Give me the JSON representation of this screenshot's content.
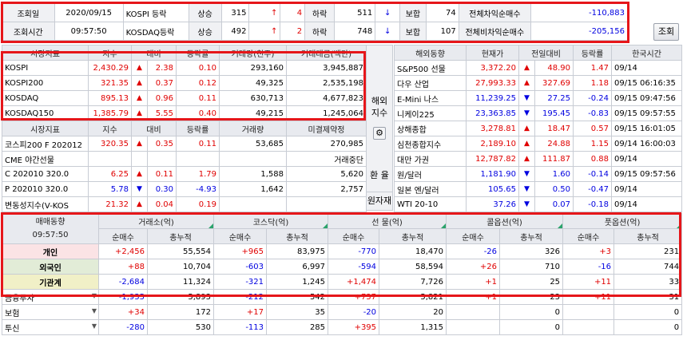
{
  "top": {
    "date_label": "조회일",
    "date_value": "2020/09/15",
    "time_label": "조회시간",
    "time_value": "09:57:50",
    "rows": [
      {
        "name": "KOSPI 등락",
        "up_label": "상승",
        "up_count": "315",
        "up_arrow": "↑",
        "up_limit": "4",
        "down_label": "하락",
        "down_count": "511",
        "down_arrow": "↓",
        "down_limit": "",
        "flat_label": "보합",
        "flat": "74",
        "arb_label": "전체차익순매수",
        "arb": "-110,883"
      },
      {
        "name": "KOSDAQ등락",
        "up_label": "상승",
        "up_count": "492",
        "up_arrow": "↑",
        "up_limit": "2",
        "down_label": "하락",
        "down_count": "748",
        "down_arrow": "↓",
        "down_limit": "",
        "flat_label": "보합",
        "flat": "107",
        "arb_label": "전체비차익순매수",
        "arb": "-205,156"
      }
    ],
    "query_button": "조회"
  },
  "market": {
    "headers": [
      "시장지표",
      "지수",
      "대비",
      "등락률",
      "거래량(천주)",
      "거래대금(백만)"
    ],
    "rows": [
      {
        "name": "KOSPI",
        "index": "2,430.29",
        "arrow": "▲",
        "chg": "2.38",
        "rate": "0.10",
        "vol": "293,160",
        "amt": "3,945,887"
      },
      {
        "name": "KOSPI200",
        "index": "321.35",
        "arrow": "▲",
        "chg": "0.37",
        "rate": "0.12",
        "vol": "49,325",
        "amt": "2,535,198"
      },
      {
        "name": "KOSDAQ",
        "index": "895.13",
        "arrow": "▲",
        "chg": "0.96",
        "rate": "0.11",
        "vol": "630,713",
        "amt": "4,677,823"
      },
      {
        "name": "KOSDAQ150",
        "index": "1,385.79",
        "arrow": "▲",
        "chg": "5.55",
        "rate": "0.40",
        "vol": "49,215",
        "amt": "1,245,064"
      }
    ]
  },
  "deriv": {
    "headers": [
      "시장지표",
      "지수",
      "대비",
      "등락률",
      "거래량",
      "미결제약정"
    ],
    "rows": [
      {
        "name": "코스피200 F 202012",
        "index": "320.35",
        "arrow": "▲",
        "chg": "0.35",
        "rate": "0.11",
        "vol": "53,685",
        "oi": "270,985"
      },
      {
        "name": "CME 야간선물",
        "index": "",
        "arrow": "",
        "chg": "",
        "rate": "",
        "vol": "",
        "oi": "거래중단"
      },
      {
        "name": "C 202010 320.0",
        "index": "6.25",
        "arrow": "▲",
        "chg": "0.11",
        "rate": "1.79",
        "vol": "1,588",
        "oi": "5,620"
      },
      {
        "name": "P 202010 320.0",
        "index": "5.78",
        "arrow": "▼",
        "chg": "0.30",
        "rate": "-4.93",
        "vol": "1,642",
        "oi": "2,757"
      },
      {
        "name": "변동성지수(V-KOS",
        "index": "21.32",
        "arrow": "▲",
        "chg": "0.04",
        "rate": "0.19",
        "vol": "",
        "oi": ""
      }
    ]
  },
  "side": {
    "overseas_label": "해외\n지수",
    "exchange_label": "환 율",
    "raw_label": "원자재"
  },
  "overseas": {
    "headers": [
      "해외동향",
      "현재가",
      "전일대비",
      "등락률",
      "한국시간"
    ],
    "rows": [
      {
        "name": "S&P500 선물",
        "price": "3,372.20",
        "arrow": "▲",
        "chg": "48.90",
        "rate": "1.47",
        "time": "09/14"
      },
      {
        "name": "다우 산업",
        "price": "27,993.33",
        "arrow": "▲",
        "chg": "327.69",
        "rate": "1.18",
        "time": "09/15 06:16:35"
      },
      {
        "name": "E-Mini 나스",
        "price": "11,239.25",
        "arrow": "▼",
        "chg": "27.25",
        "rate": "-0.24",
        "time": "09/15 09:47:56"
      },
      {
        "name": "니케이225",
        "price": "23,363.85",
        "arrow": "▼",
        "chg": "195.45",
        "rate": "-0.83",
        "time": "09/15 09:57:55"
      },
      {
        "name": "상해종합",
        "price": "3,278.81",
        "arrow": "▲",
        "chg": "18.47",
        "rate": "0.57",
        "time": "09/15 16:01:05"
      },
      {
        "name": "심천종합지수",
        "price": "2,189.10",
        "arrow": "▲",
        "chg": "24.88",
        "rate": "1.15",
        "time": "09/14 16:00:03"
      },
      {
        "name": "대만 가권",
        "price": "12,787.82",
        "arrow": "▲",
        "chg": "111.87",
        "rate": "0.88",
        "time": "09/14"
      },
      {
        "name": "원/달러",
        "price": "1,181.90",
        "arrow": "▼",
        "chg": "1.60",
        "rate": "-0.14",
        "time": "09/15 09:57:56"
      },
      {
        "name": "일본 엔/달러",
        "price": "105.65",
        "arrow": "▼",
        "chg": "0.50",
        "rate": "-0.47",
        "time": "09/14"
      },
      {
        "name": "WTI 20-10",
        "price": "37.26",
        "arrow": "▼",
        "chg": "0.07",
        "rate": "-0.18",
        "time": "09/14"
      }
    ]
  },
  "trading": {
    "title": "매매동향",
    "time": "09:57:50",
    "groups": [
      "거래소(억)",
      "코스닥(억)",
      "선  물(억)",
      "콜옵션(억)",
      "풋옵션(억)"
    ],
    "sub": [
      "순매수",
      "총누적"
    ],
    "rows": [
      {
        "name": "개인",
        "v": [
          "+2,456",
          "55,554",
          "+965",
          "83,975",
          "-770",
          "18,470",
          "-26",
          "326",
          "+3",
          "231"
        ]
      },
      {
        "name": "외국인",
        "v": [
          "+88",
          "10,704",
          "-603",
          "6,997",
          "-594",
          "58,594",
          "+26",
          "710",
          "-16",
          "744"
        ]
      },
      {
        "name": "기관계",
        "v": [
          "-2,684",
          "11,324",
          "-321",
          "1,245",
          "+1,474",
          "7,726",
          "+1",
          "25",
          "+11",
          "33"
        ]
      },
      {
        "name": "금융투자",
        "v": [
          "-1,935",
          "5,893",
          "-212",
          "542",
          "+737",
          "5,821",
          "+1",
          "23",
          "+11",
          "31"
        ]
      },
      {
        "name": "보험",
        "v": [
          "+34",
          "172",
          "+17",
          "35",
          "-20",
          "20",
          "",
          "0",
          "",
          "0"
        ]
      },
      {
        "name": "투신",
        "v": [
          "-280",
          "530",
          "-113",
          "285",
          "+395",
          "1,315",
          "",
          "0",
          "",
          "0"
        ]
      }
    ]
  },
  "colors": {
    "up": "#e00000",
    "down": "#0000e0",
    "highlight": "#e6161a",
    "header_bg": "#e8eaef"
  }
}
